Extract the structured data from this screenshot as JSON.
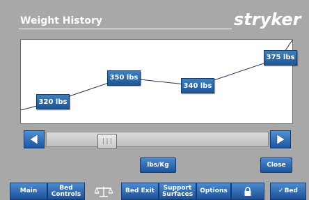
{
  "header": {
    "title": "Weight History",
    "brand": "stryker"
  },
  "chart_data": {
    "type": "line",
    "x": [
      1,
      2,
      3,
      4
    ],
    "values": [
      320,
      350,
      340,
      375
    ],
    "point_labels": [
      "320 lbs",
      "350 lbs",
      "340 lbs",
      "375 lbs"
    ],
    "unit": "lbs",
    "line_color": "#1b2f5a",
    "label_color": "#2a68ad"
  },
  "scrollbar": {
    "left_icon": "arrow-left-icon",
    "right_icon": "arrow-right-icon",
    "thumb_grip": "|||",
    "position_fraction": 0.25
  },
  "buttons": {
    "units": "lbs/Kg",
    "close": "Close"
  },
  "nav": {
    "main": "Main",
    "bed_controls_1": "Bed",
    "bed_controls_2": "Controls",
    "scale_icon": "scale-icon",
    "bed_exit": "Bed Exit",
    "support_1": "Support",
    "support_2": "Surfaces",
    "options": "Options",
    "lock_icon": "lock-icon",
    "bed_check": "Bed"
  },
  "colors": {
    "background": "#a8a8a8",
    "accent": "#2a68ad"
  }
}
